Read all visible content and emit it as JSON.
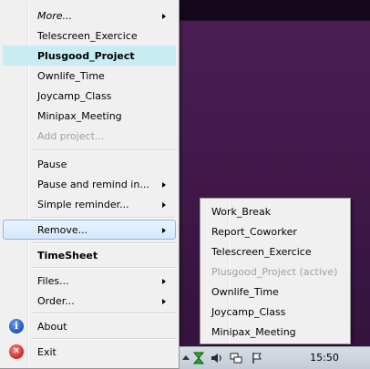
{
  "main_menu": {
    "items": [
      {
        "label": "More...",
        "has_submenu": true
      },
      {
        "label": "Telescreen_Exercice"
      },
      {
        "label": "Plusgood_Project"
      },
      {
        "label": "Ownlife_Time"
      },
      {
        "label": "Joycamp_Class"
      },
      {
        "label": "Minipax_Meeting"
      },
      {
        "label": "Add project..."
      },
      {
        "label": "Pause"
      },
      {
        "label": "Pause and remind in...",
        "has_submenu": true
      },
      {
        "label": "Simple reminder...",
        "has_submenu": true
      },
      {
        "label": "Remove...",
        "has_submenu": true
      },
      {
        "label": "TimeSheet"
      },
      {
        "label": "Files...",
        "has_submenu": true
      },
      {
        "label": "Order...",
        "has_submenu": true
      },
      {
        "label": "About",
        "icon": "info-icon"
      },
      {
        "label": "Exit",
        "icon": "exit-icon"
      }
    ],
    "about_icon_glyph": "i",
    "exit_icon_glyph": "✕"
  },
  "remove_submenu": {
    "items": [
      {
        "label": "Work_Break"
      },
      {
        "label": "Report_Coworker"
      },
      {
        "label": "Telescreen_Exercice"
      },
      {
        "label": "Plusgood_Project (active)"
      },
      {
        "label": "Ownlife_Time"
      },
      {
        "label": "Joycamp_Class"
      },
      {
        "label": "Minipax_Meeting"
      }
    ]
  },
  "taskbar": {
    "clock": "15:50",
    "tray_icons": [
      "show-hidden-icons-arrow",
      "timesheet-app-icon",
      "volume-icon",
      "network-icon",
      "action-center-flag-icon"
    ]
  },
  "colors": {
    "menu_background": "#f0f0f0",
    "highlight_current_project": "#c7edf2",
    "hover_border": "#8eb6e3",
    "disabled_text": "#a0a0a0",
    "desktop_purple": "#3d1746"
  }
}
